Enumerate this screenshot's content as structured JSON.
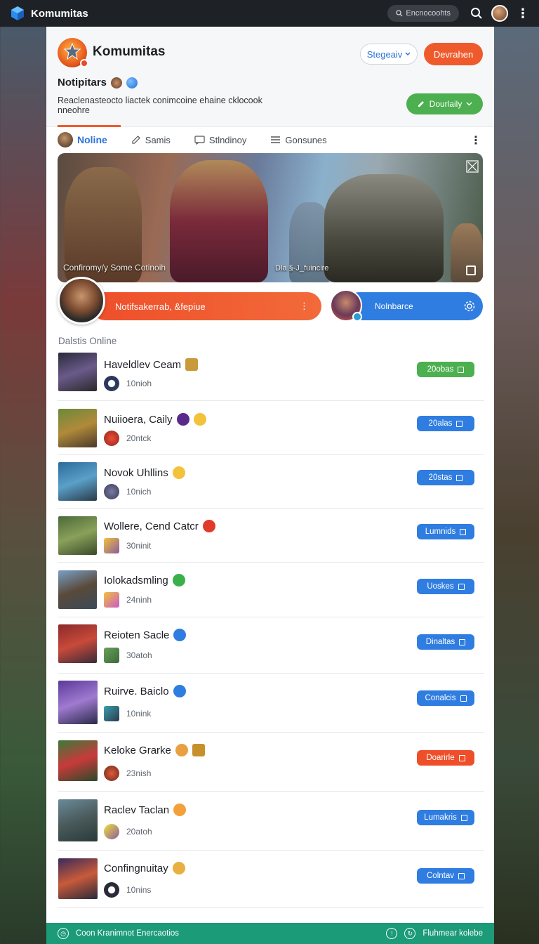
{
  "topbar": {
    "app_title": "Komumitas",
    "search_text": "Encnocoohts"
  },
  "header": {
    "community_title": "Komumitas",
    "strategy_button": "Stegeaiv",
    "join_button": "Devrahen",
    "notif_label": "Notipitars",
    "description": "Reaclenasteocto liactek conimcoine ehaine cklocook nneohre",
    "green_button": "Dourlaily"
  },
  "tabs": [
    {
      "label": "Noline"
    },
    {
      "label": "Samis"
    },
    {
      "label": "Stlndinoy"
    },
    {
      "label": "Gonsunes"
    }
  ],
  "banner": {
    "caption_left": "Confiromy/y Some Cotinoih",
    "caption_right": "Dla  §-J_fuincire"
  },
  "status": {
    "orange_text": "Notifsakerrab, &fepiue",
    "blue_text": "Nolnbarce"
  },
  "section_label": "Dalstis Online",
  "rows": [
    {
      "name": "Haveldlev Ceam",
      "time": "10nioh",
      "action": "20obas",
      "action_color": "#4caf50"
    },
    {
      "name": "Nuiioera, Caily",
      "time": "20ntck",
      "action": "20alas",
      "action_color": "#2f7de0"
    },
    {
      "name": "Novok Uhllins",
      "time": "10nich",
      "action": "20stas",
      "action_color": "#2f7de0"
    },
    {
      "name": "Wollere, Cend Catcr",
      "time": "30ninit",
      "action": "Lumnids",
      "action_color": "#2f7de0"
    },
    {
      "name": "Iolokadsmling",
      "time": "24ninh",
      "action": "Uoskes",
      "action_color": "#2f7de0"
    },
    {
      "name": "Reioten Sacle",
      "time": "30atoh",
      "action": "Dinaltas",
      "action_color": "#2f7de0"
    },
    {
      "name": "Ruirve. Baiclo",
      "time": "10nink",
      "action": "Conalcis",
      "action_color": "#2f7de0"
    },
    {
      "name": "Keloke Grarke",
      "time": "23nish",
      "action": "Doarirle",
      "action_color": "#ee4f2a"
    },
    {
      "name": "Raclev Taclan",
      "time": "20atoh",
      "action": "Lumakris",
      "action_color": "#2f7de0"
    },
    {
      "name": "Confingnuitay",
      "time": "10nins",
      "action": "Colntav",
      "action_color": "#2f7de0"
    }
  ],
  "bottom_bar": {
    "left_text": "Coon Kranimnot Enercaotios",
    "right_text": "Fluhmear kolebe"
  }
}
